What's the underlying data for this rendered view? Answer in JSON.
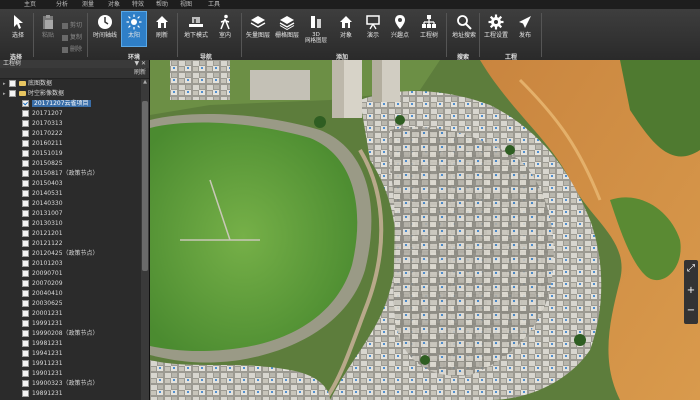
{
  "menubar": [
    "主页",
    "分析",
    "测量",
    "对象",
    "特效",
    "帮助",
    "视图",
    "工具"
  ],
  "ribbon": {
    "groups": [
      {
        "label": "选择",
        "buttons": [
          {
            "label": "选择",
            "icon": "cursor-icon"
          }
        ]
      },
      {
        "label": "",
        "buttons": [
          {
            "label": "粘贴",
            "icon": "paste-icon"
          }
        ],
        "small": [
          "剪切",
          "复制",
          "删除"
        ]
      },
      {
        "label": "环境",
        "buttons": [
          {
            "label": "时间轴线",
            "icon": "clock-icon"
          },
          {
            "label": "太阳",
            "icon": "sun-icon",
            "active": true
          },
          {
            "label": "刷新",
            "icon": "refresh-house-icon"
          }
        ]
      },
      {
        "label": "导航",
        "buttons": [
          {
            "label": "地下模式",
            "icon": "underground-icon"
          },
          {
            "label": "室内",
            "icon": "walker-icon"
          }
        ]
      },
      {
        "label": "添加",
        "buttons": [
          {
            "label": "矢量图层",
            "icon": "vector-layer-icon"
          },
          {
            "label": "栅格图层",
            "icon": "raster-layer-icon"
          },
          {
            "label": "3D\n网格图层",
            "icon": "mesh-layer-icon"
          },
          {
            "label": "对象",
            "icon": "house-object-icon"
          },
          {
            "label": "演示",
            "icon": "presentation-icon"
          },
          {
            "label": "兴趣点",
            "icon": "poi-icon"
          },
          {
            "label": "工程树",
            "icon": "project-tree-icon"
          }
        ]
      },
      {
        "label": "搜索",
        "buttons": [
          {
            "label": "地址搜索",
            "icon": "search-icon"
          }
        ]
      },
      {
        "label": "工程",
        "buttons": [
          {
            "label": "工程设置",
            "icon": "gear-icon"
          },
          {
            "label": "发布",
            "icon": "publish-icon"
          }
        ]
      }
    ]
  },
  "panel": {
    "title": "工程树",
    "controls": "▼ ✕",
    "refresh": "刷新",
    "tree": [
      {
        "label": "底图数据",
        "type": "folder",
        "level": 0
      },
      {
        "label": "时空影像数据",
        "type": "folder",
        "level": 0
      },
      {
        "label": "20171207云雀项目",
        "checked": true,
        "selected": true
      },
      {
        "label": "20171207"
      },
      {
        "label": "20170313"
      },
      {
        "label": "20170222"
      },
      {
        "label": "20160211"
      },
      {
        "label": "20151019"
      },
      {
        "label": "20150825"
      },
      {
        "label": "20150817（政策节点）"
      },
      {
        "label": "20150403"
      },
      {
        "label": "20140531"
      },
      {
        "label": "20140330"
      },
      {
        "label": "20131007"
      },
      {
        "label": "20130310"
      },
      {
        "label": "20121201"
      },
      {
        "label": "20121122"
      },
      {
        "label": "20120425（政策节点）"
      },
      {
        "label": "20101203"
      },
      {
        "label": "20090701"
      },
      {
        "label": "20070209"
      },
      {
        "label": "20040410"
      },
      {
        "label": "20030625"
      },
      {
        "label": "20001231"
      },
      {
        "label": "19991231"
      },
      {
        "label": "19990208（政策节点）"
      },
      {
        "label": "19981231"
      },
      {
        "label": "19941231"
      },
      {
        "label": "19911231"
      },
      {
        "label": "19901231"
      },
      {
        "label": "19900323（政策节点）"
      },
      {
        "label": "19891231"
      }
    ]
  },
  "map": {
    "nav": [
      "⤢",
      "+",
      "−"
    ]
  }
}
